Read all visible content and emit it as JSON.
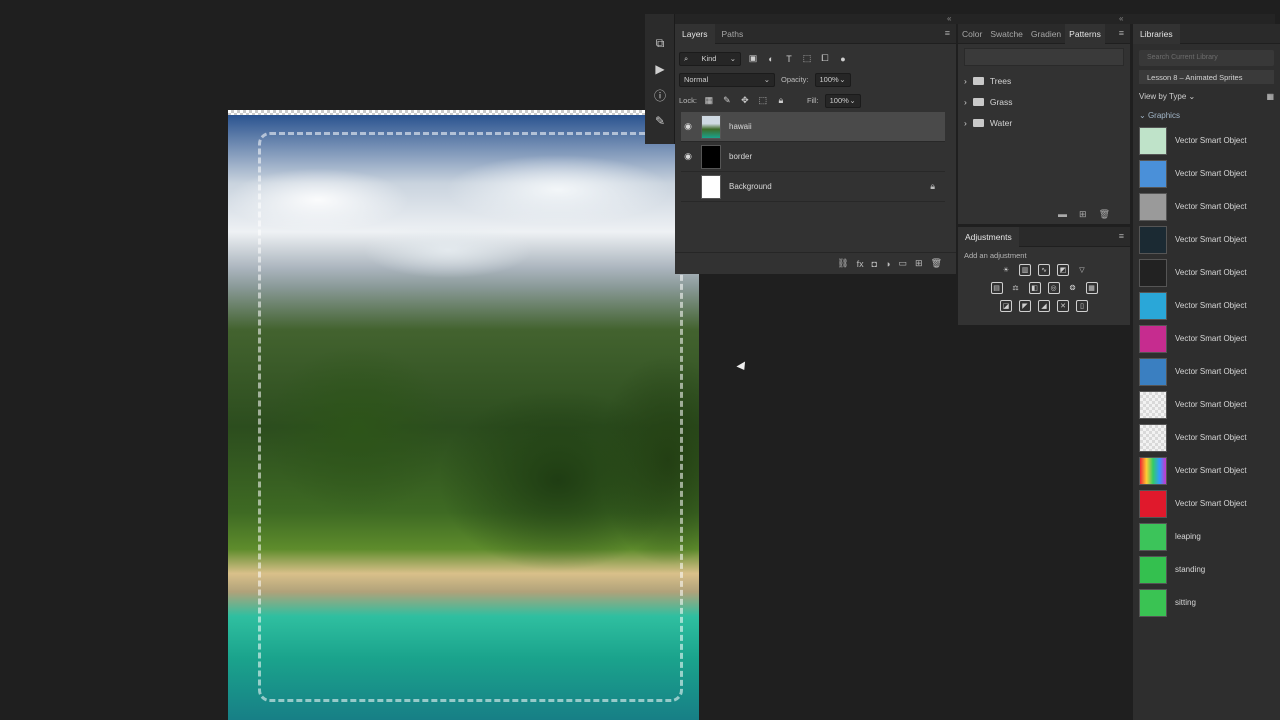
{
  "layers_panel": {
    "tabs": [
      "Layers",
      "Paths"
    ],
    "filter_kind": "Kind",
    "blend_mode": "Normal",
    "opacity_label": "Opacity:",
    "opacity_value": "100%",
    "lock_label": "Lock:",
    "fill_label": "Fill:",
    "fill_value": "100%",
    "layers": [
      {
        "name": "hawaii",
        "visible": true,
        "selected": true
      },
      {
        "name": "border",
        "visible": true,
        "selected": false
      },
      {
        "name": "Background",
        "visible": false,
        "selected": false,
        "locked": true
      }
    ]
  },
  "patterns_panel": {
    "tabs": [
      "Color",
      "Swatche",
      "Gradien",
      "Patterns"
    ],
    "folders": [
      "Trees",
      "Grass",
      "Water"
    ]
  },
  "adjustments_panel": {
    "title": "Adjustments",
    "hint": "Add an adjustment"
  },
  "libraries_panel": {
    "title": "Libraries",
    "search_placeholder": "Search Current Library",
    "library_name": "Lesson 8 – Animated Sprites",
    "view_label": "View by Type",
    "group_label": "Graphics",
    "items": [
      "Vector Smart Object",
      "Vector Smart Object",
      "Vector Smart Object",
      "Vector Smart Object",
      "Vector Smart Object",
      "Vector Smart Object",
      "Vector Smart Object",
      "Vector Smart Object",
      "Vector Smart Object",
      "Vector Smart Object",
      "Vector Smart Object",
      "Vector Smart Object",
      "leaping",
      "standing",
      "sitting"
    ]
  }
}
